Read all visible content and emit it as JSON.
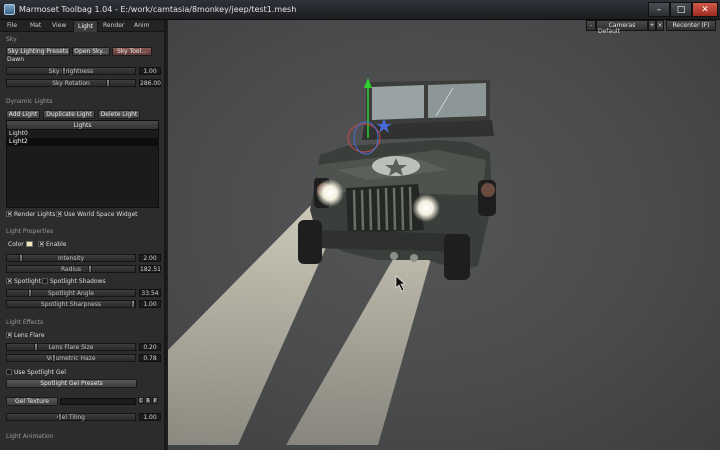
{
  "window": {
    "title": "Marmoset Toolbag 1.04 - E:/work/camtasia/8monkey/jeep/test1.mesh"
  },
  "tabs": [
    {
      "label": "File"
    },
    {
      "label": "Mat"
    },
    {
      "label": "View"
    },
    {
      "label": "Light"
    },
    {
      "label": "Render"
    },
    {
      "label": "Anim"
    }
  ],
  "sky": {
    "section": "Sky",
    "presets_btn": "Sky Lighting Presets",
    "open_btn": "Open Sky...",
    "tool_btn": "Sky Tool...",
    "preset_value": "Dawn",
    "brightness": {
      "label": "Sky Brightness",
      "value": "1.00",
      "level": 0.44
    },
    "rotation": {
      "label": "Sky Rotation",
      "value": "286.00",
      "level": 0.8
    }
  },
  "dynamic_lights": {
    "section": "Dynamic Lights",
    "add_btn": "Add Light",
    "dup_btn": "Duplicate Light",
    "del_btn": "Delete Light",
    "list_header": "Lights",
    "items": [
      "Light0",
      "Light2"
    ],
    "render_lights": "Render Lights",
    "world_space": "Use World Space Widget"
  },
  "light_properties": {
    "section": "Light Properties",
    "color_label": "Color",
    "enable_label": "Enable",
    "intensity": {
      "label": "Intensity",
      "value": "2.00",
      "level": 0.1
    },
    "radius": {
      "label": "Radius",
      "value": "182.51",
      "level": 0.65
    },
    "spotlight": "Spotlight",
    "spotlight_shadows": "Spotlight Shadows",
    "spot_angle": {
      "label": "Spotlight Angle",
      "value": "33.54",
      "level": 0.17
    },
    "spot_sharpness": {
      "label": "Spotlight Sharpness",
      "value": "1.00",
      "level": 1.0
    }
  },
  "light_effects": {
    "section": "Light Effects",
    "lens_flare": "Lens Flare",
    "flare_size": {
      "label": "Lens Flare Size",
      "value": "0.20",
      "level": 0.22
    },
    "vol_haze": {
      "label": "Volumetric Haze",
      "value": "0.78",
      "level": 0.36
    },
    "use_gel": "Use Spotlight Gel",
    "gel_presets_btn": "Spotlight Gel Presets",
    "gel_texture_btn": "Gel Texture",
    "gel_tiling": {
      "label": "Gel Tiling",
      "value": "1.00",
      "level": 0.41
    },
    "gel_tex_icons": [
      "C",
      "R",
      "P"
    ]
  },
  "light_animation": {
    "section": "Light Animation"
  },
  "viewport": {
    "cam_minus": "-",
    "cam_label": "Cameras",
    "cam_plus": "+",
    "cam_remove": "×",
    "cam_recenter": "Recenter (F)",
    "cam_current": "Default"
  },
  "colors": {
    "light_color": "#f1e6b8",
    "jeep_body": "#3f443f",
    "beam": "#d6d2bf"
  }
}
